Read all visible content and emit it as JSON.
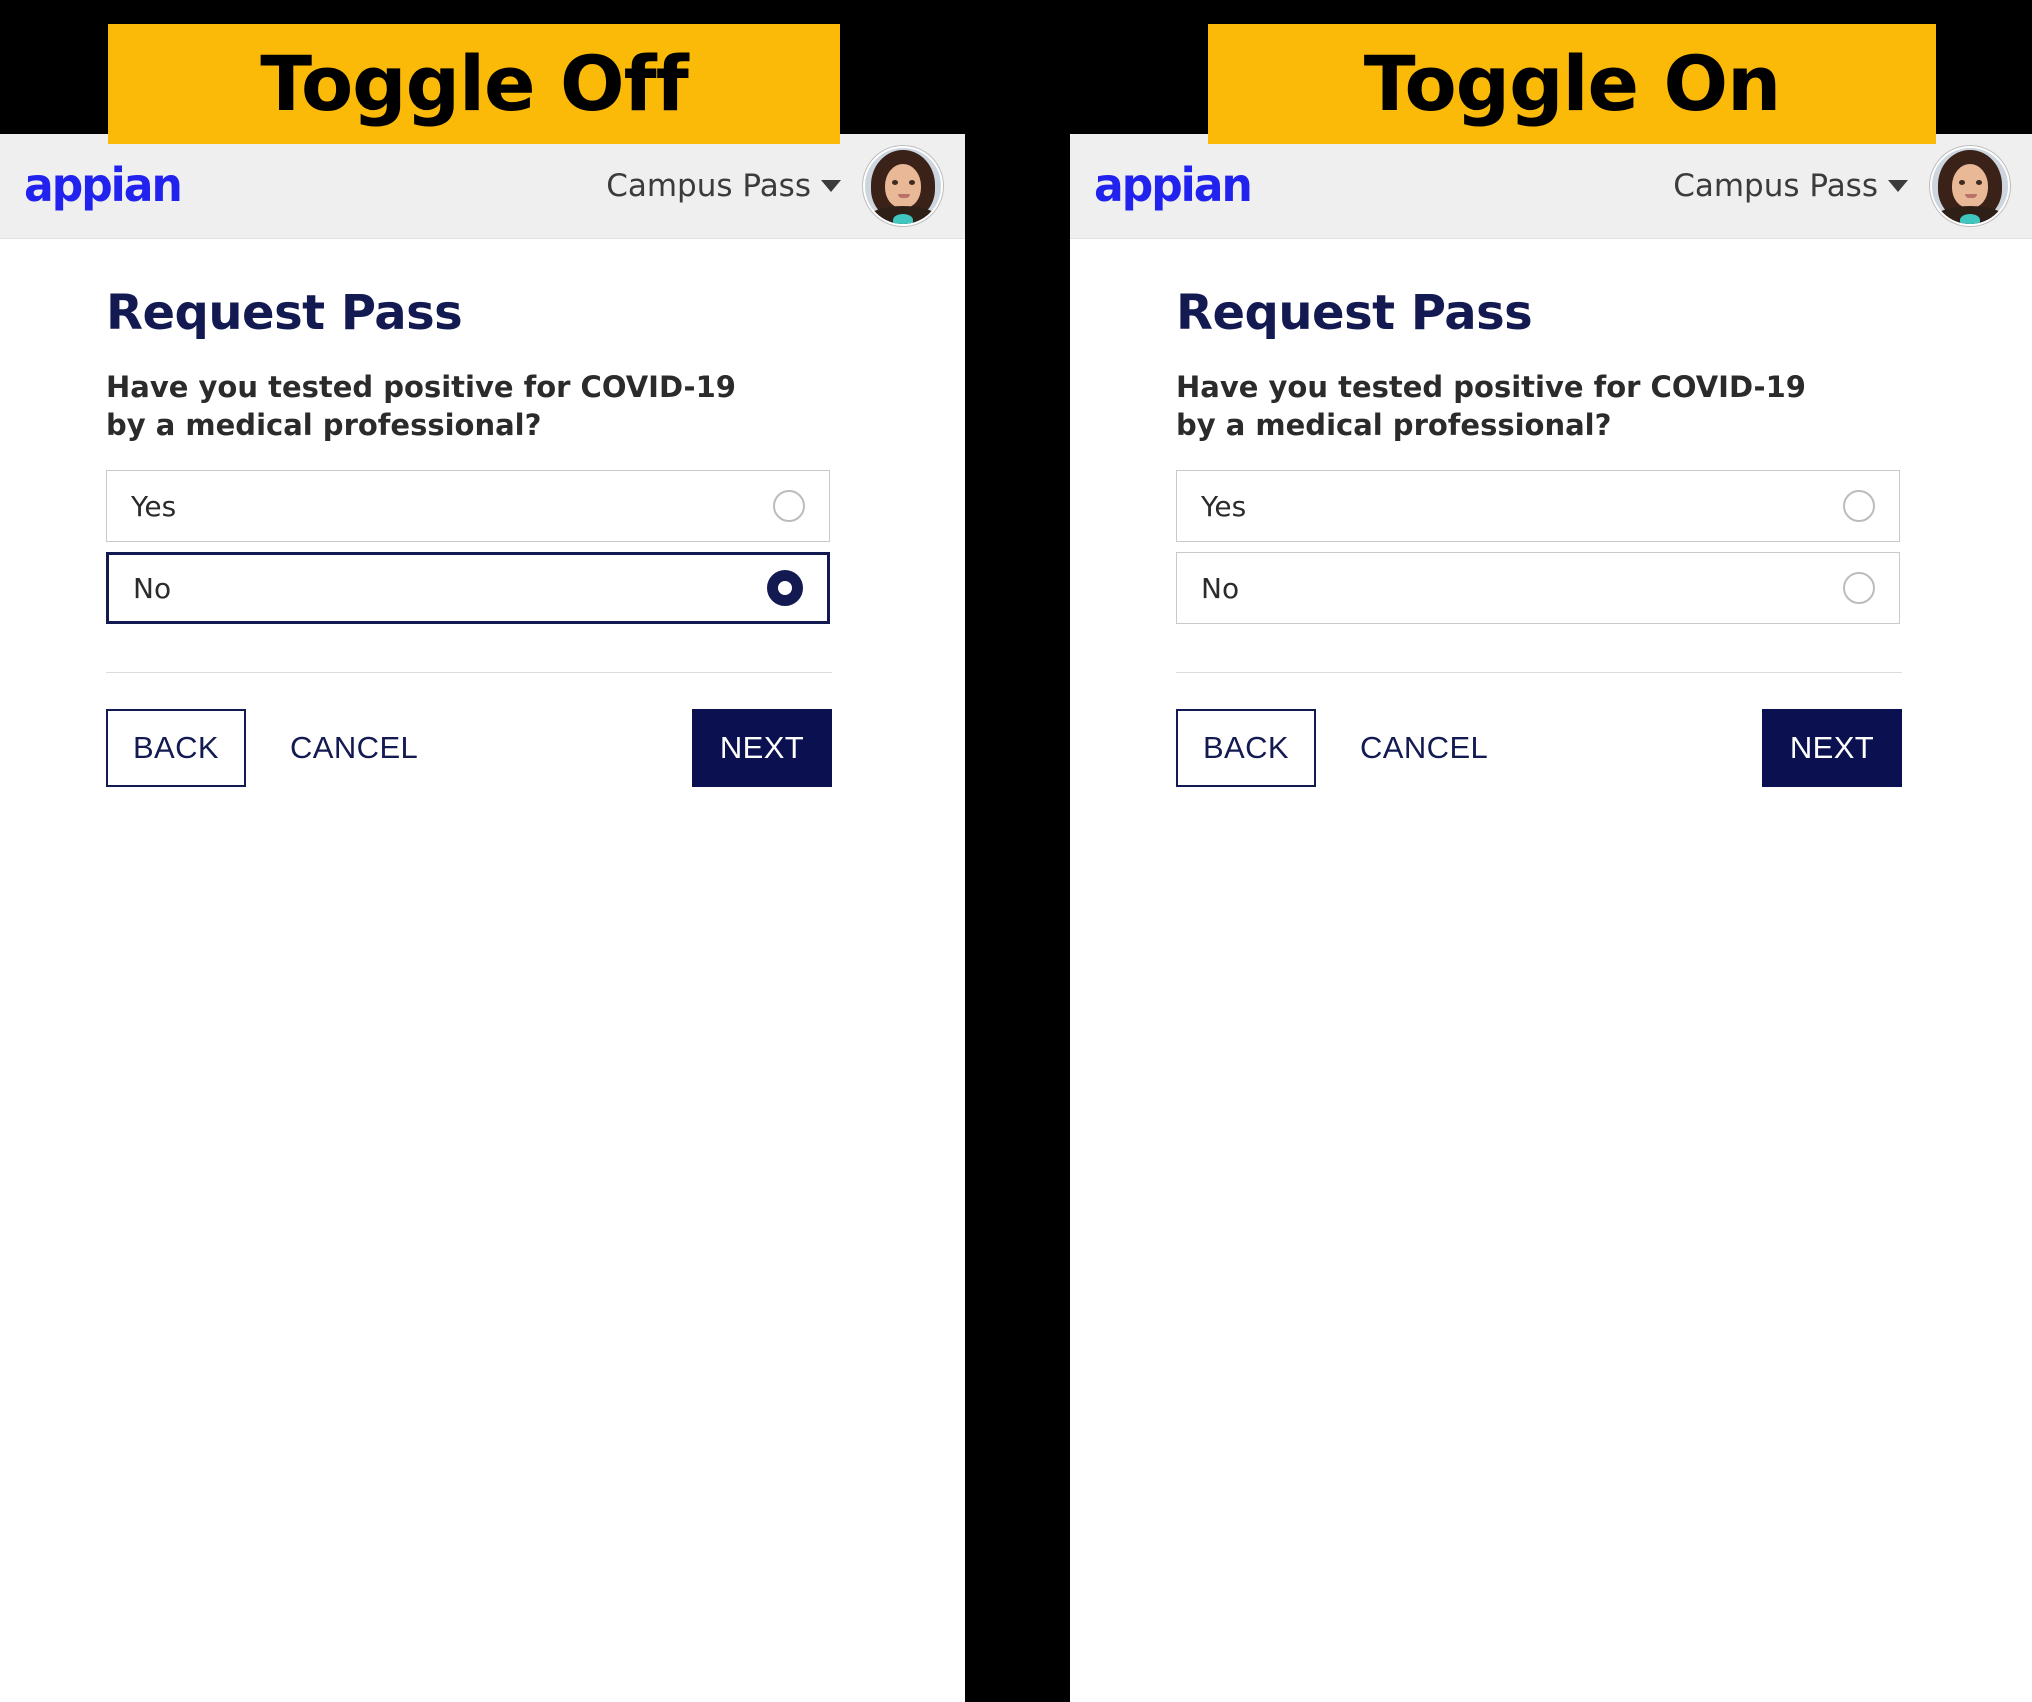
{
  "background_color": "#000000",
  "banner_color": "#FBB908",
  "accent_navy": "#131a52",
  "button_navy": "#0a1050",
  "logo_blue": "#2222ee",
  "header_bg": "#efefef",
  "panels": [
    {
      "banner_label": "Toggle Off",
      "header": {
        "logo_text": "appian",
        "app_name": "Campus Pass",
        "caret_icon": "chevron-down-icon",
        "avatar_icon": "user-avatar"
      },
      "page_title": "Request Pass",
      "question": "Have you tested positive for COVID-19 by a medical professional?",
      "options": [
        {
          "label": "Yes",
          "selected": false
        },
        {
          "label": "No",
          "selected": true
        }
      ],
      "actions": {
        "back": "BACK",
        "cancel": "CANCEL",
        "next": "NEXT"
      }
    },
    {
      "banner_label": "Toggle On",
      "header": {
        "logo_text": "appian",
        "app_name": "Campus Pass",
        "caret_icon": "chevron-down-icon",
        "avatar_icon": "user-avatar"
      },
      "page_title": "Request Pass",
      "question": "Have you tested positive for COVID-19 by a medical professional?",
      "options": [
        {
          "label": "Yes",
          "selected": false
        },
        {
          "label": "No",
          "selected": false
        }
      ],
      "actions": {
        "back": "BACK",
        "cancel": "CANCEL",
        "next": "NEXT"
      }
    }
  ]
}
